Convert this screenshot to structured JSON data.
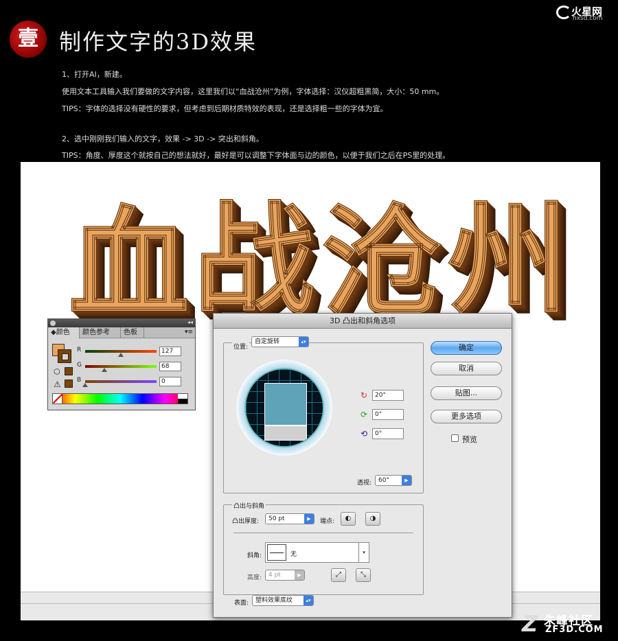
{
  "site_logo": {
    "word": "火星网",
    "url": "hxsd.com"
  },
  "seal": {
    "char": "壹"
  },
  "heading": "制作文字的3D效果",
  "intro": {
    "l1": "1、打开AI，新建。",
    "l2": "使用文本工具输入我们要做的文字内容，这里我们以“血战沧州”为例，字体选择：汉仪超粗黑简，大小：50 mm。",
    "l3": "TIPS：字体的选择没有硬性的要求，但考虑到后期材质特效的表现，还是选择粗一些的字体为宜。",
    "l4": "2、选中刚刚我们输入的文字，效果 -> 3D -> 突出和斜角。",
    "l5": "TIPS：角度、厚度这个就按自己的想法就好，最好是可以调整下字体面与边的颜色，以便于我们之后在PS里的处理。"
  },
  "artwork": {
    "c1": "血",
    "c2": "战",
    "c3": "沧",
    "c4": "州",
    "fill_color": "#e9a55e",
    "side_color": "#6e3a14"
  },
  "color_panel": {
    "tabs": [
      "颜色",
      "颜色参考",
      "色板"
    ],
    "r_label": "R",
    "g_label": "G",
    "b_label": "B",
    "r_value": "127",
    "g_value": "68",
    "b_value": "0",
    "r": 127,
    "g": 68,
    "b": 0,
    "fill_swatch": "#e9a55e",
    "stroke_swatch": "#7f4400"
  },
  "dialog": {
    "title": "3D 凸出和斜角选项",
    "position_label": "位置:",
    "position_value": "自定旋转",
    "rot_x": "20°",
    "rot_y": "0°",
    "rot_z": "0°",
    "perspective_label": "透视:",
    "perspective_value": "60°",
    "extrude_group": "凸出与斜角",
    "depth_label": "凸出厚度:",
    "depth_value": "50 pt",
    "cap_label": "端点:",
    "bevel_label": "斜角:",
    "bevel_value": "无",
    "height_label": "高度:",
    "height_value": "4 pt",
    "surface_label": "表面:",
    "surface_value": "塑料效果底纹",
    "ok": "确定",
    "cancel": "取消",
    "map": "贴图...",
    "more": "更多选项",
    "preview": "预览"
  },
  "watermark": {
    "cn": "朱峰社区",
    "en": "ZF3D.COM"
  }
}
